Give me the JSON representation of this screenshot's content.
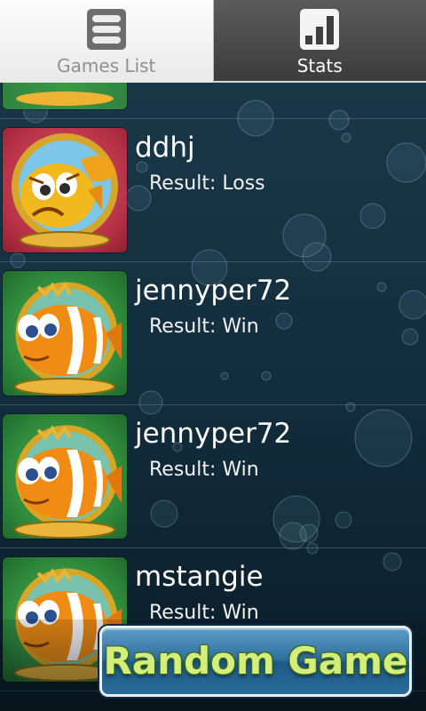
{
  "tabs": [
    {
      "label": "Games List",
      "icon": "list-icon",
      "active": true
    },
    {
      "label": "Stats",
      "icon": "bar-chart-icon",
      "active": false
    }
  ],
  "games": [
    {
      "name": "ddhj",
      "result": "Result: Loss",
      "avatar": "sad-goldfish-icon",
      "avatar_bg": "#b73146"
    },
    {
      "name": "jennyper72",
      "result": "Result: Win",
      "avatar": "clownfish-icon",
      "avatar_bg": "#2f8a3c"
    },
    {
      "name": "jennyper72",
      "result": "Result: Win",
      "avatar": "clownfish-icon",
      "avatar_bg": "#2f8a3c"
    },
    {
      "name": "mstangie",
      "result": "Result: Win",
      "avatar": "clownfish-icon",
      "avatar_bg": "#2f8a3c"
    }
  ],
  "random_button": {
    "label": "Random Game"
  },
  "colors": {
    "background": "#163447",
    "button_text": "#d3ee7c",
    "button_fill": "#2d6e9f"
  }
}
